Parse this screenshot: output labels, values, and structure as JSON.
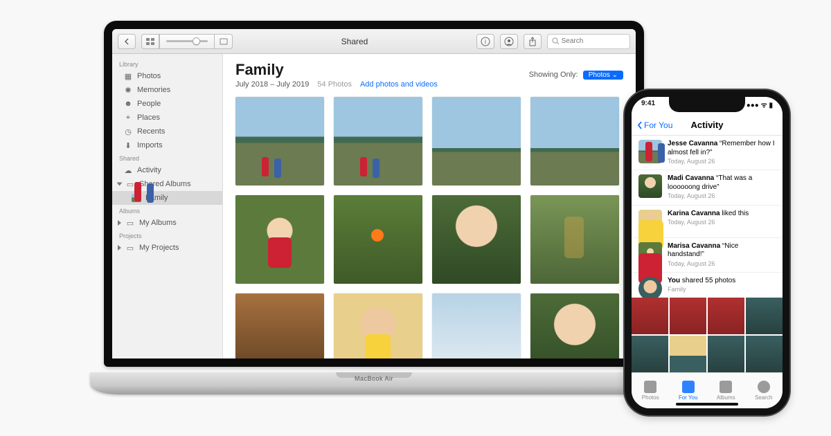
{
  "device_label": "MacBook Air",
  "toolbar": {
    "title": "Shared",
    "search_placeholder": "Search"
  },
  "sidebar": {
    "sections": [
      {
        "heading": "Library",
        "items": [
          "Photos",
          "Memories",
          "People",
          "Places",
          "Recents",
          "Imports"
        ]
      },
      {
        "heading": "Shared",
        "items": [
          "Activity",
          "Shared Albums"
        ],
        "children_of_1": [
          "Family"
        ]
      },
      {
        "heading": "Albums",
        "items": [
          "My Albums"
        ]
      },
      {
        "heading": "Projects",
        "items": [
          "My Projects"
        ]
      }
    ],
    "selected": "Family"
  },
  "album": {
    "title": "Family",
    "date_range": "July 2018 – July 2019",
    "count_label": "54 Photos",
    "add_link": "Add photos and videos",
    "filter_label": "Showing Only:",
    "filter_value": "Photos"
  },
  "photo_tiles": [
    "lake",
    "lake",
    "fish",
    "fish",
    "kid1",
    "grass",
    "closeup",
    "tree",
    "brick",
    "boy",
    "sky",
    "closeup"
  ],
  "iphone": {
    "status_time": "9:41",
    "back_label": "For You",
    "nav_title": "Activity",
    "activity": [
      {
        "name": "Jesse Cavanna",
        "quote": "“Remember how I almost fell in?”",
        "time": "Today, August 26",
        "thumb": "lake"
      },
      {
        "name": "Madi Cavanna",
        "quote": "“That was a loooooong drive”",
        "time": "Today, August 26",
        "thumb": "closeup"
      },
      {
        "name": "Karina Cavanna",
        "quote": "liked this",
        "time": "Today, August 26",
        "thumb": "boy"
      },
      {
        "name": "Marisa Cavanna",
        "quote": "“Nice handstand!”",
        "time": "Today, August 26",
        "thumb": "kid1"
      }
    ],
    "summary": {
      "name": "You",
      "text": "shared 55 photos",
      "sub": "Family"
    },
    "thumb_row": [
      "red",
      "red",
      "red",
      "teal",
      "teal",
      "stripe",
      "teal",
      "teal"
    ],
    "tabs": [
      "Photos",
      "For You",
      "Albums",
      "Search"
    ],
    "active_tab": 1
  }
}
